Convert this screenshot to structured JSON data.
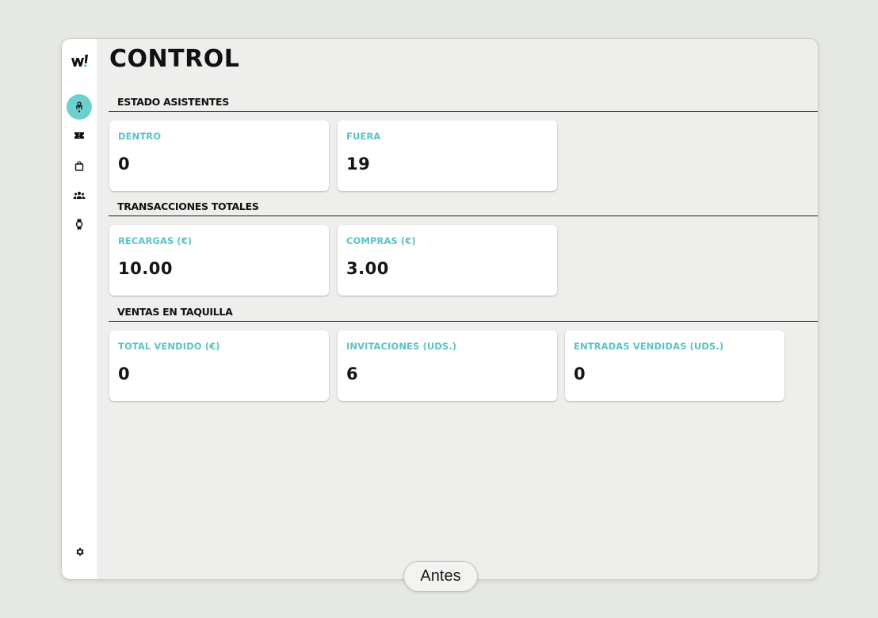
{
  "app": {
    "logo_text": "W!",
    "accent_color": "#6fcfcf"
  },
  "sidebar": {
    "items": [
      {
        "icon": "attendees-icon",
        "active": true
      },
      {
        "icon": "ticket-icon",
        "active": false
      },
      {
        "icon": "shopping-bag-icon",
        "active": false
      },
      {
        "icon": "users-group-icon",
        "active": false
      },
      {
        "icon": "wristband-icon",
        "active": false
      }
    ],
    "settings_icon": "gear-icon"
  },
  "page": {
    "title": "CONTROL"
  },
  "sections": [
    {
      "title": "ESTADO ASISTENTES",
      "cards": [
        {
          "label": "DENTRO",
          "value": "0"
        },
        {
          "label": "FUERA",
          "value": "19"
        }
      ]
    },
    {
      "title": "TRANSACCIONES TOTALES",
      "cards": [
        {
          "label": "RECARGAS (€)",
          "value": "10.00"
        },
        {
          "label": "COMPRAS (€)",
          "value": "3.00"
        }
      ]
    },
    {
      "title": "VENTAS EN TAQUILLA",
      "cards": [
        {
          "label": "TOTAL VENDIDO (€)",
          "value": "0"
        },
        {
          "label": "INVITACIONES (UDS.)",
          "value": "6"
        },
        {
          "label": "ENTRADAS VENDIDAS (UDS.)",
          "value": "0"
        }
      ]
    }
  ],
  "footer": {
    "antes_label": "Antes"
  }
}
